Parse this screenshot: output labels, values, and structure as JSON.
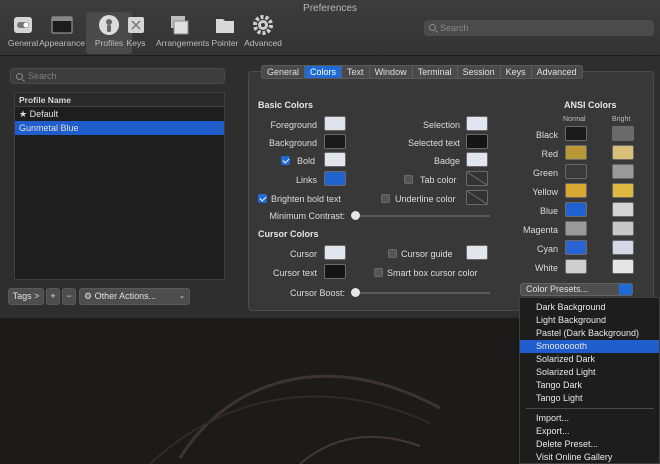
{
  "window": {
    "title": "Preferences"
  },
  "toolbar": {
    "items": [
      {
        "label": "General",
        "icon": "general-switch-icon"
      },
      {
        "label": "Appearance",
        "icon": "appearance-window-icon"
      },
      {
        "label": "Profiles",
        "icon": "profiles-person-icon",
        "selected": true
      },
      {
        "label": "Keys",
        "icon": "keys-keyboard-icon"
      },
      {
        "label": "Arrangements",
        "icon": "arrangements-icon"
      },
      {
        "label": "Pointer",
        "icon": "pointer-folder-icon"
      },
      {
        "label": "Advanced",
        "icon": "advanced-gear-icon"
      }
    ],
    "search_placeholder": "Search"
  },
  "profiles": {
    "search_placeholder": "Search",
    "header": "Profile Name",
    "items": [
      {
        "label": "Default",
        "star": true
      },
      {
        "label": "Gunmetal Blue",
        "selected": true
      }
    ],
    "tags_label": "Tags >",
    "add_label": "+",
    "remove_label": "−",
    "other_actions_label": "Other Actions..."
  },
  "tabs": [
    "General",
    "Colors",
    "Text",
    "Window",
    "Terminal",
    "Session",
    "Keys",
    "Advanced"
  ],
  "selected_tab": "Colors",
  "basic_colors": {
    "title": "Basic Colors",
    "foreground": "Foreground",
    "background": "Background",
    "bold": "Bold",
    "links": "Links",
    "selection": "Selection",
    "selected_text": "Selected text",
    "badge": "Badge",
    "tab_color": "Tab color",
    "underline_color": "Underline color",
    "brighten_bold": "Brighten bold text",
    "minimum_contrast": "Minimum Contrast:"
  },
  "cursor_colors": {
    "title": "Cursor Colors",
    "cursor": "Cursor",
    "cursor_text": "Cursor text",
    "cursor_guide": "Cursor guide",
    "smart_box": "Smart box cursor color",
    "cursor_boost": "Cursor Boost:"
  },
  "ansi": {
    "title": "ANSI Colors",
    "normal": "Normal",
    "bright": "Bright",
    "rows": [
      {
        "name": "Black",
        "normal": "#1a1a1a",
        "bright": "#6a6a6a"
      },
      {
        "name": "Red",
        "normal": "#b9983a",
        "bright": "#d8c07a"
      },
      {
        "name": "Green",
        "normal": "#3a3a3a",
        "bright": "#9a9a9a"
      },
      {
        "name": "Yellow",
        "normal": "#d8a830",
        "bright": "#e0b840"
      },
      {
        "name": "Blue",
        "normal": "#1e62d0",
        "bright": "#d4d4d4"
      },
      {
        "name": "Magenta",
        "normal": "#9a9a9a",
        "bright": "#c8c8c8"
      },
      {
        "name": "Cyan",
        "normal": "#2a64d4",
        "bright": "#d6d6e8"
      },
      {
        "name": "White",
        "normal": "#cfcfcf",
        "bright": "#e6e6e6"
      }
    ]
  },
  "color_presets": {
    "label": "Color Presets...",
    "items": [
      "Dark Background",
      "Light Background",
      "Pastel (Dark Background)",
      "Smooooooth",
      "Solarized Dark",
      "Solarized Light",
      "Tango Dark",
      "Tango Light"
    ],
    "selected": "Smooooooth",
    "actions": [
      "Import...",
      "Export...",
      "Delete Preset...",
      "Visit Online Gallery"
    ]
  },
  "colors": {
    "accent": "#1f6bd6",
    "foreground_swatch": "#dfe3ec",
    "background_swatch": "#1b1b1b",
    "bold_swatch": "#e4e6ee",
    "links_swatch": "#1f62d0",
    "selection_swatch": "#e1e6f0",
    "selected_text_swatch": "#151515",
    "badge_swatch": "#e2e5ee",
    "cursor_swatch": "#e2e6ee",
    "cursor_text_swatch": "#151515",
    "cursor_guide_swatch": "#e2e6ee"
  }
}
